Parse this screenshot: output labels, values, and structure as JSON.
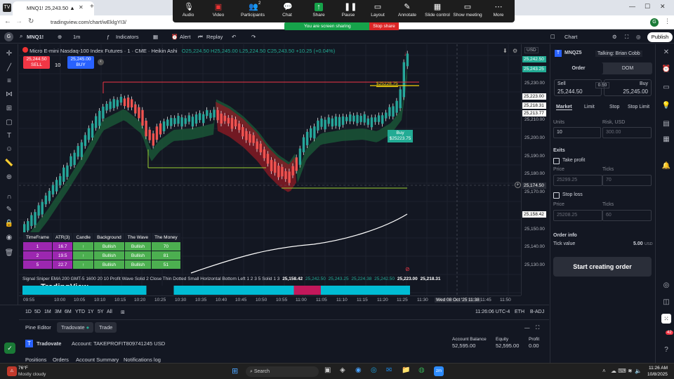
{
  "browser": {
    "tab_title": "MNQ1! 25,243.50 ▲ +0.82% C...",
    "url": "tradingview.com/chart/wEklgYI3/"
  },
  "zoom": {
    "items": [
      "Audio",
      "Video",
      "Participants",
      "Chat",
      "Share",
      "Pause",
      "Layout",
      "Annotate",
      "Slide control",
      "Show meeting",
      "More"
    ],
    "participants_count": "2",
    "sharing_text": "You are screen sharing",
    "stop_share": "Stop share",
    "talking": "Talking: Brian Cobb"
  },
  "toolbar": {
    "symbol": "MNQ1!",
    "interval": "1m",
    "indicators": "Indicators",
    "alert": "Alert",
    "replay": "Replay",
    "chart": "Chart",
    "publish": "Publish"
  },
  "legend": {
    "title": "Micro E-mini Nasdaq-100 Index Futures · 1 · CME · Heikin Ashi",
    "ohlc": "O25,224.50 H25,245.00 L25,224.50 C25,243.50 +10.25 (+0.04%)"
  },
  "order_boxes": {
    "sell_price": "25,244.50",
    "sell_label": "SELL",
    "qty": "10",
    "buy_price": "25,245.00",
    "buy_label": "BUY"
  },
  "chart_labels": {
    "limit_label": "$25228.75",
    "buy_tag": "Buy",
    "buy_tag_price": "$25223.75"
  },
  "price_axis": {
    "currency": "USD",
    "levels": [
      "25,230.00",
      "25,210.00",
      "25,200.00",
      "25,190.00",
      "25,180.00",
      "25,170.00",
      "25,150.00",
      "25,140.00",
      "25,130.00"
    ],
    "tags": [
      {
        "v": "25,242.50"
      },
      {
        "v": "25,243.25"
      },
      {
        "v": "25,223.00"
      },
      {
        "v": "25,218.31"
      },
      {
        "v": "25,213.77"
      },
      {
        "v": "25,174.50"
      },
      {
        "v": "25,158.42"
      }
    ]
  },
  "time_axis": [
    "09:55",
    "10:00",
    "10:05",
    "10:10",
    "10:15",
    "10:20",
    "10:25",
    "10:30",
    "10:35",
    "10:40",
    "10:45",
    "10:50",
    "10:55",
    "11:00",
    "11:05",
    "11:10",
    "11:15",
    "11:20",
    "11:25",
    "11:30",
    "Wed 08 Oct '25",
    "11:38",
    "11:45",
    "11:50"
  ],
  "ranges": [
    "1D",
    "5D",
    "1M",
    "3M",
    "6M",
    "YTD",
    "1Y",
    "5Y",
    "All"
  ],
  "clock": "11:26:06 UTC-4",
  "session": "ETH",
  "adj": "B-ADJ",
  "indicator_line": {
    "text": "Signal Sniper EMA 200 GMT-5 1600 20 10 Profit Wave Solid 2 Close Thin Dotted Small Horizontal Bottom Left 1 2 3 5 Solid 1 3",
    "v1": "25,158.42",
    "v2": "25,242.50",
    "v3": "25,243.25",
    "v4": "25,224.38",
    "v5": "25,242.50",
    "v6": "25,223.00",
    "v7": "25,218.31",
    "watermark": "TradingView"
  },
  "table": {
    "headers": [
      "TimeFrame",
      "ATR(3)",
      "Candle",
      "Background",
      "The Wave",
      "The Money"
    ],
    "rows": [
      [
        "1",
        "16.7",
        "↑",
        "Bullish",
        "Bullish",
        "70"
      ],
      [
        "2",
        "19.5",
        "↑",
        "Bullish",
        "Bullish",
        "81"
      ],
      [
        "5",
        "22.7",
        "↑",
        "Bullish",
        "Bullish",
        "51"
      ]
    ]
  },
  "bottom_panel": {
    "tabs": [
      "Pine Editor",
      "Tradovate",
      "Trade"
    ],
    "broker": "Tradovate",
    "account": "Account: TAKEPROFIT809741245 USD",
    "balance_label": "Account Balance",
    "balance": "52,595.00",
    "equity_label": "Equity",
    "equity": "52,595.00",
    "profit_label": "Profit",
    "profit": "0.00",
    "subtabs": [
      "Positions",
      "Orders",
      "Account Summary",
      "Notifications log"
    ]
  },
  "order_panel": {
    "symbol": "MNQZ5",
    "tabs": [
      "Order",
      "DOM"
    ],
    "sell_label": "Sell",
    "sell_price": "25,244.50",
    "spread": "0.50",
    "buy_label": "Buy",
    "buy_price": "25,245.00",
    "types": [
      "Market",
      "Limit",
      "Stop",
      "Stop Limit"
    ],
    "units_label": "Units",
    "units": "10",
    "risk_label": "Risk, USD",
    "risk": "300.00",
    "exits": "Exits",
    "take_profit": "Take profit",
    "price_label": "Price",
    "ticks_label": "Ticks",
    "tp_price": "25299.25",
    "tp_ticks": "70",
    "stop_loss": "Stop loss",
    "sl_price": "25208.25",
    "sl_ticks": "60",
    "order_info": "Order info",
    "tick_value_label": "Tick value",
    "tick_value": "5.00",
    "tick_value_unit": "USD",
    "submit": "Start creating order"
  },
  "taskbar": {
    "temp": "76°F",
    "weather": "Mostly cloudy",
    "search": "Search",
    "time": "11:26 AM",
    "date": "10/8/2025",
    "badge": "42"
  }
}
